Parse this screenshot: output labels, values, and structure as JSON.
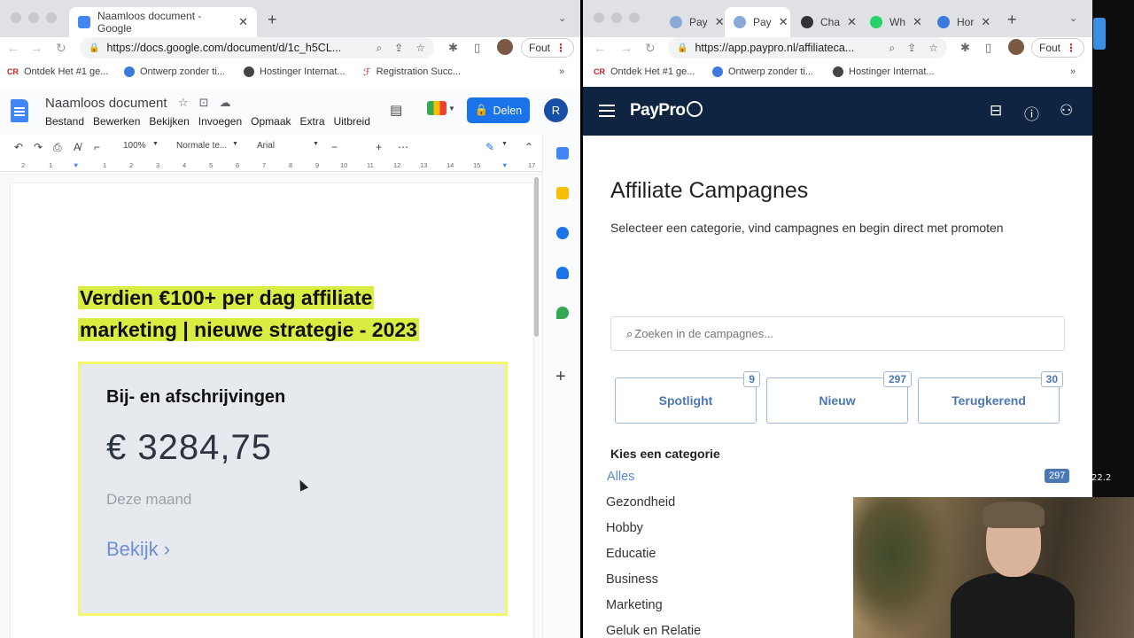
{
  "left_browser": {
    "tabs": [
      {
        "title": "Naamloos document - Google",
        "active": true
      }
    ],
    "url": "https://docs.google.com/document/d/1c_h5CL...",
    "profile_status": "Fout",
    "bookmarks": [
      "Ontdek Het #1 ge...",
      "Ontwerp zonder ti...",
      "Hostinger Internat...",
      "Registration Succ..."
    ]
  },
  "docs": {
    "title": "Naamloos document",
    "menu": [
      "Bestand",
      "Bewerken",
      "Bekijken",
      "Invoegen",
      "Opmaak",
      "Extra",
      "Uitbreid"
    ],
    "share_label": "Delen",
    "user_initial": "R",
    "zoom": "100%",
    "style": "Normale te...",
    "font": "Arial",
    "ruler_numbers": [
      "2",
      "1",
      "1",
      "2",
      "3",
      "4",
      "5",
      "6",
      "7",
      "8",
      "9",
      "10",
      "11",
      "12",
      "13",
      "14",
      "15",
      "16",
      "17"
    ],
    "heading_line1": "Verdien €100+ per dag affiliate",
    "heading_line2": "marketing | nieuwe strategie - 2023",
    "card": {
      "title": "Bij- en afschrijvingen",
      "amount": "€ 3284,75",
      "period": "Deze maand",
      "link": "Bekijk ›"
    }
  },
  "right_browser": {
    "tabs": [
      {
        "title": "Pay",
        "active": false
      },
      {
        "title": "Pay",
        "active": true
      },
      {
        "title": "Cha",
        "active": false
      },
      {
        "title": "Wh",
        "active": false
      },
      {
        "title": "Hor",
        "active": false
      }
    ],
    "url": "https://app.paypro.nl/affiliateca...",
    "profile_status": "Fout",
    "bookmarks": [
      "Ontdek Het #1 ge...",
      "Ontwerp zonder ti...",
      "Hostinger Internat..."
    ]
  },
  "paypro": {
    "logo": "PayPro",
    "page_title": "Affiliate Campagnes",
    "lead": "Selecteer een categorie, vind campagnes en begin direct met promoten",
    "search_placeholder": "Zoeken in de campagnes...",
    "filters": [
      {
        "label": "Spotlight",
        "count": "9"
      },
      {
        "label": "Nieuw",
        "count": "297"
      },
      {
        "label": "Terugkerend",
        "count": "30"
      }
    ],
    "category_heading": "Kies een categorie",
    "categories": [
      "Alles",
      "Gezondheid",
      "Hobby",
      "Educatie",
      "Business",
      "Marketing",
      "Geluk en Relatie"
    ],
    "all_count": "297"
  },
  "desktop_edge_text": "22.2",
  "colors": {
    "docs_blue": "#1a73e8",
    "highlight_yellow": "#d9ec42",
    "paypro_navy": "#0f2440",
    "paypro_accent": "#4b77b7"
  }
}
